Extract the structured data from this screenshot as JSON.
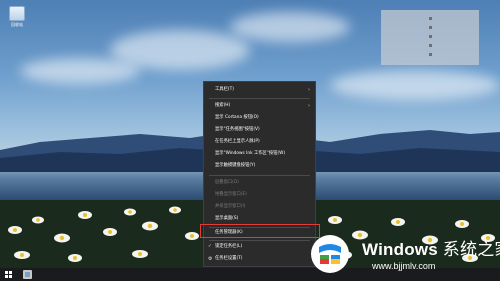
{
  "desktop": {
    "icon_label": "回收站"
  },
  "context_menu": {
    "items": [
      {
        "label": "工具栏(T)",
        "submenu": true,
        "enabled": true
      },
      {
        "label": "搜索(H)",
        "submenu": true,
        "enabled": true
      },
      {
        "label": "显示 Cortana 按钮(O)",
        "enabled": true
      },
      {
        "label": "显示\"任务视图\"按钮(V)",
        "enabled": true
      },
      {
        "label": "在任务栏上显示人脉(P)",
        "enabled": true
      },
      {
        "label": "显示\"Windows Ink 工作区\"按钮(W)",
        "enabled": true
      },
      {
        "label": "显示触摸键盘按钮(Y)",
        "enabled": true
      },
      {
        "label": "层叠窗口(D)",
        "enabled": false
      },
      {
        "label": "堆叠显示窗口(E)",
        "enabled": false
      },
      {
        "label": "并排显示窗口(I)",
        "enabled": false
      },
      {
        "label": "显示桌面(S)",
        "enabled": true
      },
      {
        "label": "任务管理器(K)",
        "enabled": true,
        "highlighted": true
      },
      {
        "label": "锁定任务栏(L)",
        "enabled": true,
        "checked": true
      },
      {
        "label": "任务栏设置(T)",
        "enabled": true,
        "icon": "gear-icon"
      }
    ]
  },
  "watermark": {
    "brand": "Windows",
    "brand_cn": "系统之家",
    "url": "www.bjjmlv.com"
  },
  "colors": {
    "menu_bg": "#2b2b2b",
    "highlight_border": "#e23b3b",
    "taskbar_bg": "#1a1b1f"
  }
}
